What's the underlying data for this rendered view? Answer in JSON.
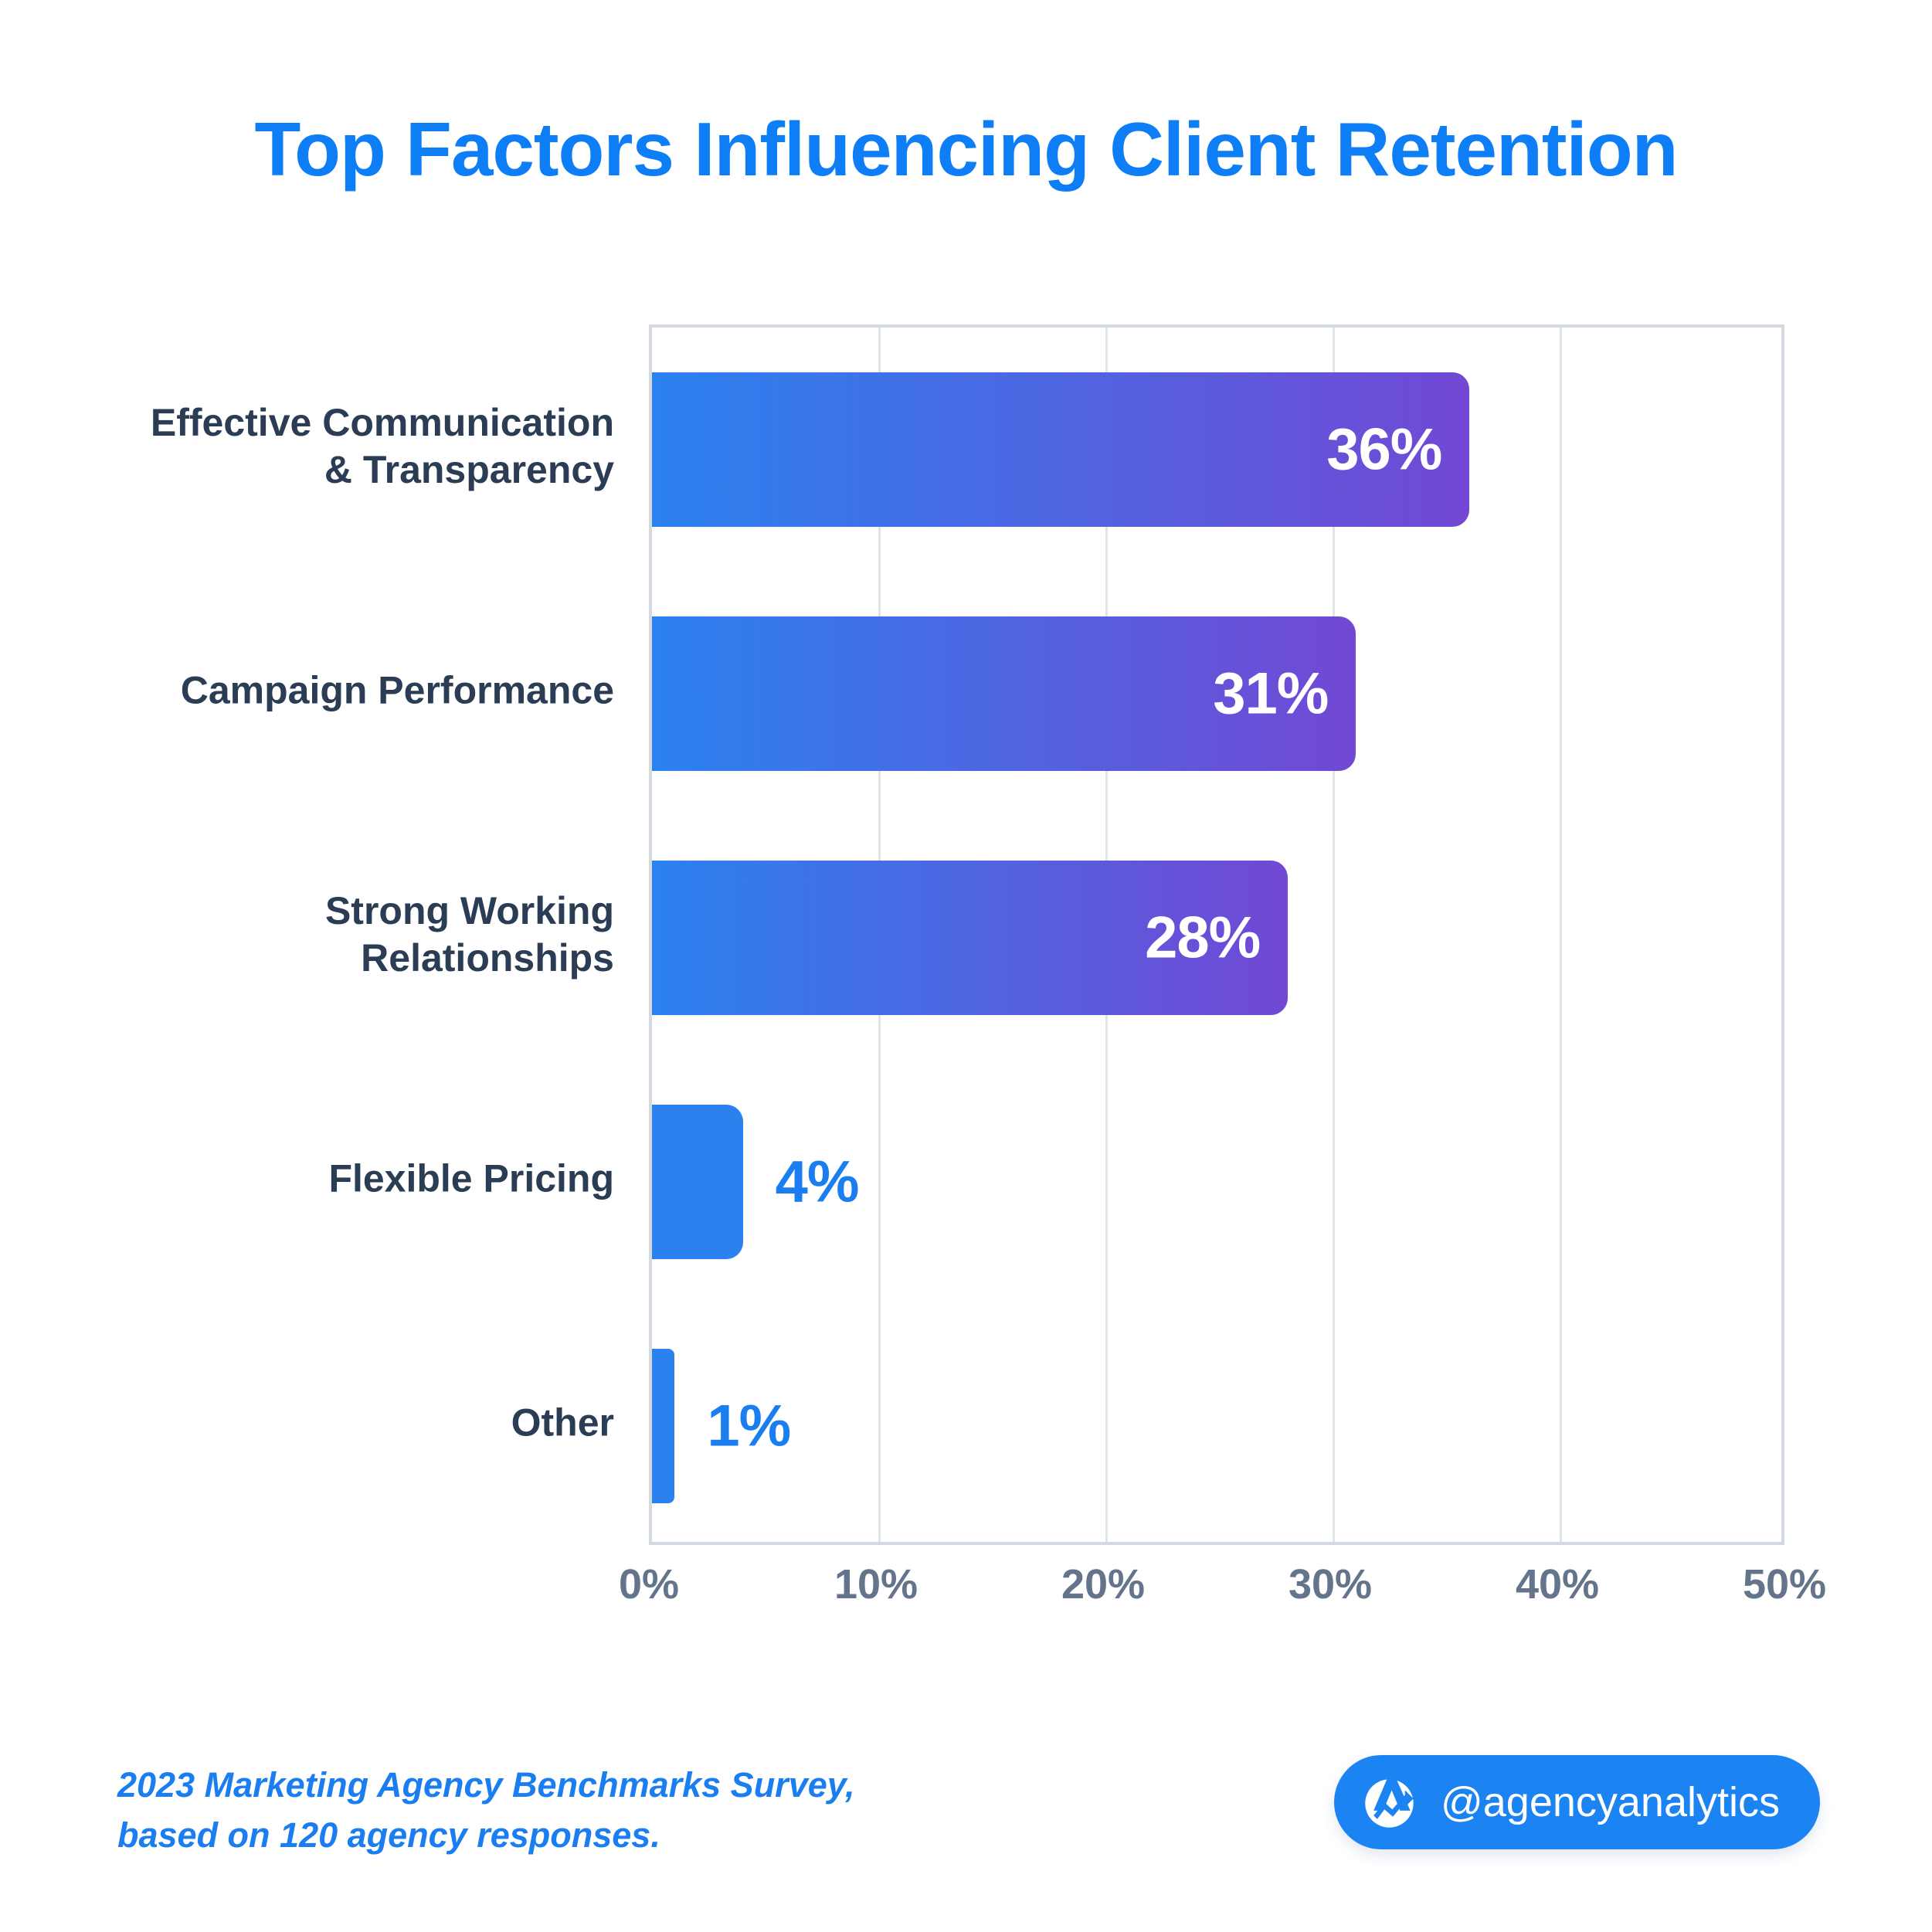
{
  "title": "Top Factors Influencing Client Retention",
  "colors": {
    "title": "#0d7ef5",
    "category_label": "#2b3d54",
    "tick_label": "#64748b",
    "bar_gradient_start": "#2b82ef",
    "bar_gradient_end": "#7248d4",
    "bar_solid": "#2b82ef",
    "value_inside": "#ffffff",
    "value_outside": "#1b7ef0",
    "grid": "#e0e5ea",
    "axis_border": "#d3d9e0",
    "badge_background": "#1b84f2",
    "background": "#ffffff"
  },
  "footer": {
    "source_line1": "2023 Marketing Agency Benchmarks Survey,",
    "source_line2": "based on 120 agency responses.",
    "handle": "@agencyanalytics",
    "logo_icon": "agencyanalytics-logo-icon"
  },
  "chart_data": {
    "type": "bar",
    "orientation": "horizontal",
    "title": "Top Factors Influencing Client Retention",
    "xlabel": "",
    "ylabel": "",
    "xlim": [
      0,
      50
    ],
    "grid": true,
    "legend": "none",
    "categories": [
      "Effective Communication & Transparency",
      "Campaign Performance",
      "Strong Working Relationships",
      "Flexible Pricing",
      "Other"
    ],
    "category_lines": [
      [
        "Effective Communication",
        "& Transparency"
      ],
      [
        "Campaign Performance"
      ],
      [
        "Strong Working",
        "Relationships"
      ],
      [
        "Flexible Pricing"
      ],
      [
        "Other"
      ]
    ],
    "values": [
      36,
      31,
      28,
      4,
      1
    ],
    "value_labels": [
      "36%",
      "31%",
      "28%",
      "4%",
      "1%"
    ],
    "label_placement": [
      "inside",
      "inside",
      "inside",
      "outside",
      "outside"
    ],
    "xticks": [
      0,
      10,
      20,
      30,
      40,
      50
    ],
    "xtick_labels": [
      "0%",
      "10%",
      "20%",
      "30%",
      "40%",
      "50%"
    ]
  }
}
